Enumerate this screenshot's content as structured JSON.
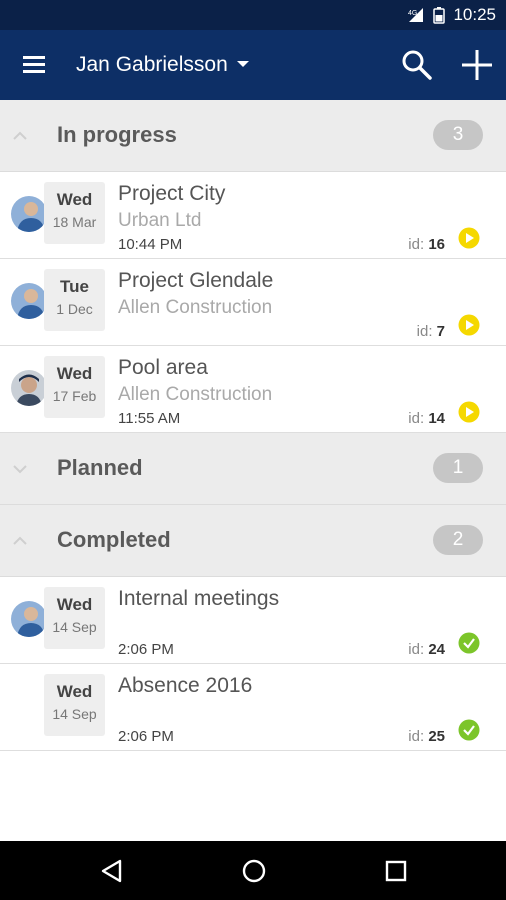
{
  "status_bar": {
    "time": "10:25",
    "signal": "4G"
  },
  "app_bar": {
    "title": "Jan Gabrielsson"
  },
  "sections": {
    "in_progress": {
      "title": "In progress",
      "count": "3"
    },
    "planned": {
      "title": "Planned",
      "count": "1"
    },
    "completed": {
      "title": "Completed",
      "count": "2"
    }
  },
  "rows": [
    {
      "dow": "Wed",
      "day": "18 Mar",
      "title": "Project City",
      "sub": "Urban Ltd",
      "time": "10:44 PM",
      "id_label": "id:",
      "id": "16",
      "status": "in-progress"
    },
    {
      "dow": "Tue",
      "day": "1 Dec",
      "title": "Project Glendale",
      "sub": "Allen Construction",
      "time": "",
      "id_label": "id:",
      "id": "7",
      "status": "in-progress"
    },
    {
      "dow": "Wed",
      "day": "17 Feb",
      "title": "Pool area",
      "sub": "Allen Construction",
      "time": "11:55 AM",
      "id_label": "id:",
      "id": "14",
      "status": "in-progress"
    },
    {
      "dow": "Wed",
      "day": "14 Sep",
      "title": "Internal meetings",
      "sub": "",
      "time": "2:06 PM",
      "id_label": "id:",
      "id": "24",
      "status": "completed"
    },
    {
      "dow": "Wed",
      "day": "14 Sep",
      "title": "Absence 2016",
      "sub": "",
      "time": "2:06 PM",
      "id_label": "id:",
      "id": "25",
      "status": "completed"
    }
  ],
  "colors": {
    "app_bar": "#0d2f66",
    "status_bar": "#0b2148",
    "in_progress": "#f5d800",
    "completed": "#7cc52a",
    "section_bg": "#ececec"
  }
}
